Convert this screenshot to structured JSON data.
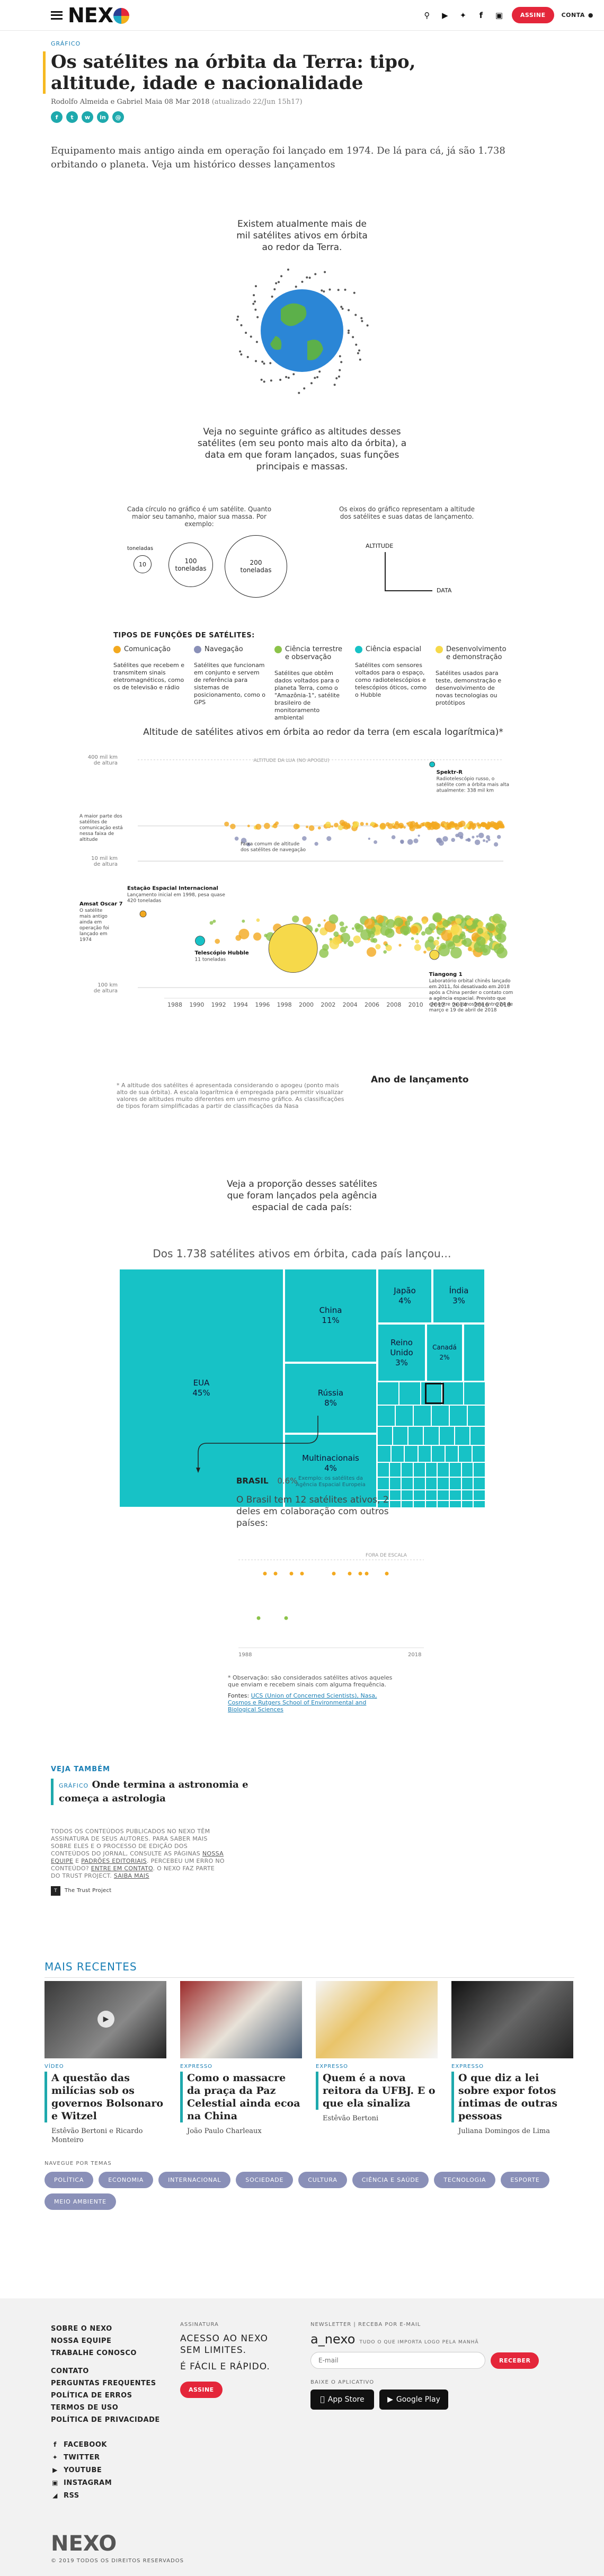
{
  "header": {
    "logo": "NEXO",
    "assine": "ASSINE",
    "conta": "CONTA",
    "icons": [
      "search-icon",
      "youtube-icon",
      "twitter-icon",
      "facebook-icon",
      "instagram-icon"
    ]
  },
  "article": {
    "kicker": "GRÁFICO",
    "title": "Os satélites na órbita da Terra: tipo, altitude, idade e nacionalidade",
    "byline": "Rodolfo Almeida e Gabriel Maia",
    "date": "08 Mar 2018",
    "updated": "(atualizado 22/Jun 15h17)",
    "lede": "Equipamento mais antigo ainda em operação foi lançado em 1974. De lá para cá, já são 1.738 orbitando o planeta. Veja um histórico desses lançamentos"
  },
  "intro": {
    "earth_text": "Existem atualmente mais de mil satélites ativos em órbita ao redor da Terra.",
    "chart_intro": "Veja no seguinte gráfico as altitudes desses satélites (em seu ponto mais alto da órbita), a data em que foram lançados, suas funções principais e massas.",
    "size_explain": "Cada círculo no gráfico é um satélite. Quanto maior seu tamanho, maior sua massa. Por exemplo:",
    "axes_explain": "Os eixos do gráfico representam a altitude dos satélites e suas datas de lançamento.",
    "size_examples": [
      "10",
      "100",
      "200"
    ],
    "toneladas": "toneladas",
    "axis_altitude": "ALTITUDE",
    "axis_data": "DATA"
  },
  "functions": {
    "heading": "TIPOS DE FUNÇÕES DE SATÉLITES:",
    "items": [
      {
        "name": "Comunicação",
        "color": "#f3a91f",
        "desc": "Satélites que recebem e transmitem sinais eletromagnéticos, como os de televisão e rádio"
      },
      {
        "name": "Navegação",
        "color": "#8a90b8",
        "desc": "Satélites que funcionam em conjunto e servem de referência para sistemas de posicionamento, como o GPS"
      },
      {
        "name": "Ciência terrestre e observação",
        "color": "#8cc34a",
        "desc": "Satélites que obtêm dados voltados para o planeta Terra, como o \"Amazônia-1\", satélite brasileiro de monitoramento ambiental"
      },
      {
        "name": "Ciência espacial",
        "color": "#17c2c6",
        "desc": "Satélites com sensores voltados para o espaço, como radiotelescópios e telescópios óticos, como o Hubble"
      },
      {
        "name": "Desenvolvimento e demonstração",
        "color": "#f6d94a",
        "desc": "Satélites usados para teste, demonstração e desenvolvimento de novas tecnologias ou protótipos"
      }
    ]
  },
  "chart_data": [
    {
      "type": "scatter",
      "title": "Altitude de satélites ativos em órbita ao redor da terra (em escala logarítmica)*",
      "xlabel": "Ano de lançamento",
      "ylabel": "",
      "x_ticks": [
        "1988",
        "1990",
        "1992",
        "1994",
        "1996",
        "1998",
        "2000",
        "2002",
        "2004",
        "2006",
        "2008",
        "2010",
        "2012",
        "2014",
        "2016",
        "2018"
      ],
      "y_ticks": [
        "400 mil km de altura",
        "10 mil km de altura",
        "100 km de altura"
      ],
      "y_scale": "log",
      "ylim": [
        100,
        400000
      ],
      "moon_label": "ALTITUDE DA LUA (NO APOGEU)",
      "annotations": [
        {
          "label": "Spektr-R",
          "text": "Radiotelescópio russo, o satélite com a órbita mais alta atualmente: 338 mil km"
        },
        {
          "label": "",
          "text": "A maior parte dos satélites de comunicação está nessa faixa de altitude"
        },
        {
          "label": "",
          "text": "Faixa comum de altitude dos satélites de navegação"
        },
        {
          "label": "Estação Espacial Internacional",
          "text": "Lançamento inicial em 1998, pesa quase 420 toneladas"
        },
        {
          "label": "Amsat Oscar 7",
          "text": "O satélite mais antigo ainda em operação foi lançado em 1974"
        },
        {
          "label": "Telescópio Hubble",
          "text": "11 toneladas"
        },
        {
          "label": "Tiangong 1",
          "text": "Laboratório orbital chinês lançado em 2011, foi desativado em 2018 após a China perder o contato com a agência espacial. Previsto que ele entre na atmosfera entre 24 de março e 19 de abril de 2018"
        }
      ],
      "footnote": "* A altitude dos satélites é apresentada considerando o apogeu (ponto mais alto de sua órbita). A escala logarítmica é empregada para permitir visualizar valores de altitudes muito diferentes em um mesmo gráfico. As classificações de tipos foram simplificadas a partir de classificações da Nasa"
    },
    {
      "type": "treemap",
      "title": "Dos 1.738 satélites ativos em órbita, cada país lançou…",
      "items": [
        {
          "name": "EUA",
          "value": 45,
          "unit": "%"
        },
        {
          "name": "China",
          "value": 11,
          "unit": "%"
        },
        {
          "name": "Rússia",
          "value": 8,
          "unit": "%"
        },
        {
          "name": "Multinacionais",
          "value": 4,
          "unit": "%"
        },
        {
          "name": "Japão",
          "value": 4,
          "unit": "%"
        },
        {
          "name": "Índia",
          "value": 3,
          "unit": "%"
        },
        {
          "name": "Reino Unido",
          "value": 3,
          "unit": "%"
        },
        {
          "name": "Canadá",
          "value": 2,
          "unit": "%"
        }
      ],
      "multinational_note": "Exemplo: os satélites da Agência Espacial Europeia"
    },
    {
      "type": "scatter",
      "title": "BRASIL",
      "value_label": "0.6%",
      "x_ticks": [
        "1988",
        "2018"
      ],
      "fora_de_escala": "FORA DE ESCALA"
    }
  ],
  "proportion_text": "Veja a proporção desses satélites que foram lançados pela agência espacial de cada país:",
  "brasil_text": "O Brasil tem 12 satélites ativos, 2 deles em colaboração com outros países:",
  "notes": {
    "obs": "* Observação: são considerados satélites ativos aqueles que enviam e recebem sinais com alguma frequência.",
    "fontes_label": "Fontes:",
    "fontes": "UCS (Union of Concerned Scientists), Nasa, Cosmos e Rutgers School of Environmental and Biological Sciences"
  },
  "veja": {
    "heading": "VEJA TAMBÉM",
    "kicker": "GRÁFICO",
    "title": "Onde termina a astronomia e começa a astrologia"
  },
  "disclaimer": {
    "p1": "TODOS OS CONTEÚDOS PUBLICADOS NO NEXO TÊM ASSINATURA DE SEUS AUTORES. PARA SABER MAIS SOBRE ELES E O PROCESSO DE EDIÇÃO DOS CONTEÚDOS DO JORNAL, CONSULTE AS PÁGINAS",
    "link1": "NOSSA EQUIPE",
    "p2": "E",
    "link2": "PADRÕES EDITORIAIS",
    "p3": ". PERCEBEU UM ERRO NO CONTEÚDO?",
    "link3": "ENTRE EM CONTATO",
    "p4": ". O NEXO FAZ PARTE DO TRUST PROJECT.",
    "link4": "SAIBA MAIS",
    "trust": "The Trust Project"
  },
  "recent": {
    "heading": "MAIS RECENTES",
    "cards": [
      {
        "kicker": "VÍDEO",
        "title": "A questão das milícias sob os governos Bolsonaro e Witzel",
        "author": "Estêvão Bertoni e Ricardo Monteiro"
      },
      {
        "kicker": "EXPRESSO",
        "title": "Como o massacre da praça da Paz Celestial ainda ecoa na China",
        "author": "João Paulo Charleaux"
      },
      {
        "kicker": "EXPRESSO",
        "title": "Quem é a nova reitora da UFBJ. E o que ela sinaliza",
        "author": "Estêvão Bertoni"
      },
      {
        "kicker": "EXPRESSO",
        "title": "O que diz a lei sobre expor fotos íntimas de outras pessoas",
        "author": "Juliana Domingos de Lima"
      }
    ],
    "tags_label": "NAVEGUE POR TEMAS",
    "tags": [
      "POLÍTICA",
      "ECONOMIA",
      "INTERNACIONAL",
      "SOCIEDADE",
      "CULTURA",
      "CIÊNCIA E SAÚDE",
      "TECNOLOGIA",
      "ESPORTE",
      "MEIO AMBIENTE"
    ]
  },
  "footer": {
    "links1": [
      "SOBRE O NEXO",
      "NOSSA EQUIPE",
      "TRABALHE CONOSCO"
    ],
    "links2": [
      "CONTATO",
      "PERGUNTAS FREQUENTES",
      "POLÍTICA DE ERROS",
      "TERMOS DE USO",
      "POLÍTICA DE PRIVACIDADE"
    ],
    "social": [
      {
        "label": "FACEBOOK",
        "icon": "facebook-icon"
      },
      {
        "label": "TWITTER",
        "icon": "twitter-icon"
      },
      {
        "label": "YOUTUBE",
        "icon": "youtube-icon"
      },
      {
        "label": "INSTAGRAM",
        "icon": "instagram-icon"
      },
      {
        "label": "RSS",
        "icon": "rss-icon"
      }
    ],
    "assinatura_label": "ASSINATURA",
    "assinatura_title": "ACESSO AO NEXO SEM LIMITES.",
    "assinatura_sub": "É FÁCIL E RÁPIDO.",
    "assine": "ASSINE",
    "newsletter_label": "NEWSLETTER | RECEBA POR E-MAIL",
    "newsletter_brand": "a_nexo",
    "newsletter_desc": "TUDO O QUE IMPORTA LOGO PELA MANHÃ",
    "email_placeholder": "E-mail",
    "receber": "RECEBER",
    "app_label": "BAIXE O APLICATIVO",
    "appstore": "App Store",
    "googleplay": "Google Play",
    "copyright": "© 2019 TODOS OS DIREITOS RESERVADOS"
  }
}
